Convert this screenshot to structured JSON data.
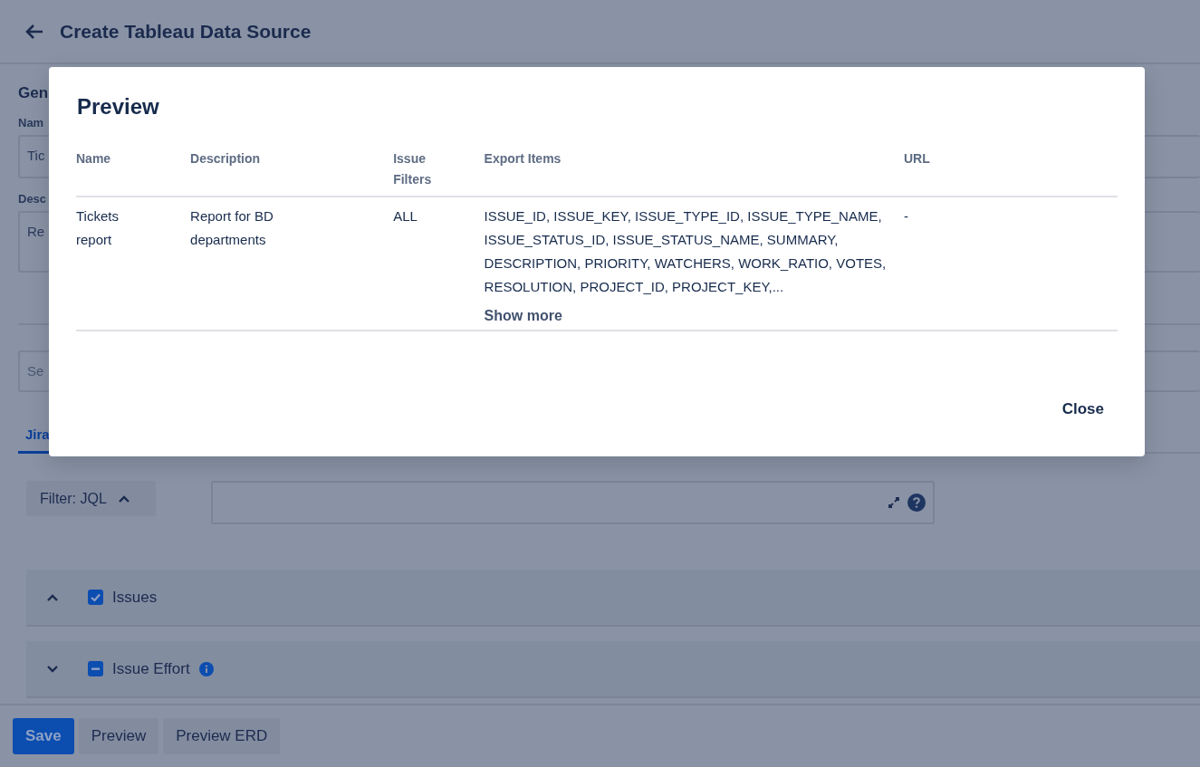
{
  "header": {
    "title": "Create Tableau Data Source"
  },
  "form": {
    "section_title": "Gen",
    "name_label": "Nam",
    "name_value": "Tic",
    "description_label": "Desc",
    "description_value": "Re",
    "search_placeholder": "Se"
  },
  "tabs": [
    {
      "label": "Jira",
      "selected": true
    }
  ],
  "filter": {
    "label": "Filter: JQL",
    "expanded": true
  },
  "sections": [
    {
      "label": "Issues",
      "expanded": true,
      "checked": true,
      "info": false
    },
    {
      "label": "Issue Effort",
      "expanded": false,
      "indeterminate": true,
      "info": true
    }
  ],
  "footer": {
    "buttons": [
      {
        "label": "Save",
        "kind": "primary"
      },
      {
        "label": "Preview",
        "kind": "secondary"
      },
      {
        "label": "Preview ERD",
        "kind": "secondary"
      }
    ]
  },
  "modal": {
    "title": "Preview",
    "table": {
      "columns": [
        "Name",
        "Description",
        "Issue Filters",
        "Export Items",
        "URL"
      ],
      "rows": [
        {
          "cells": [
            "Tickets report",
            "Report for BD departments",
            "ALL",
            "ISSUE_ID, ISSUE_KEY, ISSUE_TYPE_ID, ISSUE_TYPE_NAME, ISSUE_STATUS_ID, ISSUE_STATUS_NAME, SUMMARY, DESCRIPTION, PRIORITY, WATCHERS, WORK_RATIO, VOTES, RESOLUTION, PROJECT_ID, PROJECT_KEY,...",
            "-"
          ],
          "more": "Show more"
        }
      ]
    },
    "close": "Close"
  }
}
